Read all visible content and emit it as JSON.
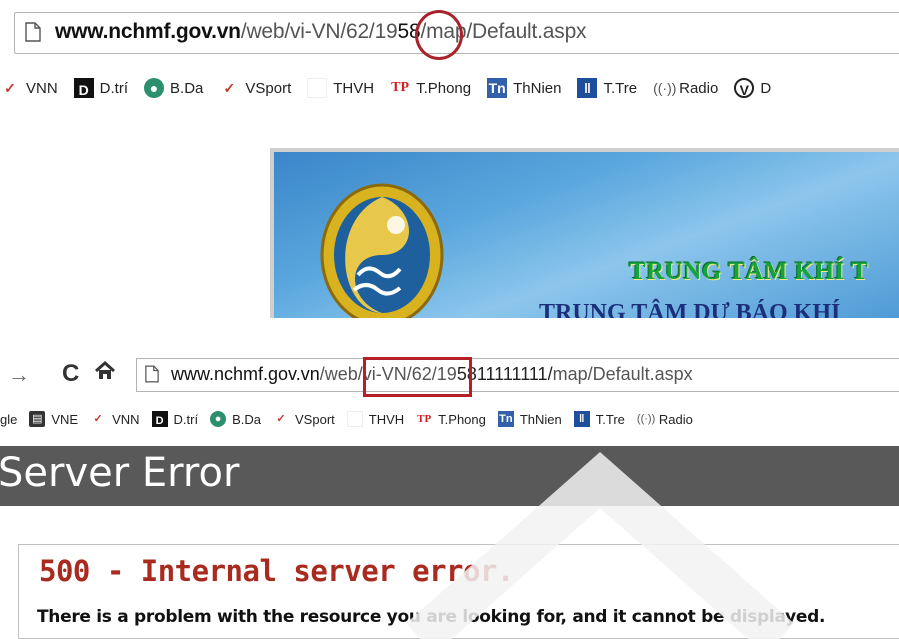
{
  "top": {
    "url": {
      "host": "www.nchmf.gov.vn",
      "path_before": "/web/vi-VN/62/19",
      "highlight": "58",
      "path_after": "/map/Default.aspx"
    },
    "bookmarks": [
      {
        "label": "VNN",
        "icon": "check-icon"
      },
      {
        "label": "D.trí",
        "icon": "d-icon",
        "glyph": "D"
      },
      {
        "label": "B.Da",
        "icon": "bda-icon"
      },
      {
        "label": "VSport",
        "icon": "check-icon"
      },
      {
        "label": "THVH",
        "icon": "blank-icon"
      },
      {
        "label": "T.Phong",
        "icon": "tp-icon",
        "glyph": "TP"
      },
      {
        "label": "ThNien",
        "icon": "tn-icon",
        "glyph": "Tn"
      },
      {
        "label": "T.Tre",
        "icon": "tt-icon"
      },
      {
        "label": "Radio",
        "icon": "radio-icon"
      },
      {
        "label": "D",
        "icon": "v-icon",
        "glyph": "V"
      }
    ],
    "banner": {
      "title": "TRUNG TÂM KHÍ T",
      "subtitle": "TRUNG TÂM DỰ BÁO KHÍ"
    }
  },
  "bottom": {
    "url": {
      "host": "www.nchmf.gov.vn",
      "path_before": "/web/vi-VN/62/19",
      "highlight": "5811111111/",
      "path_after": "map/Default.aspx"
    },
    "bookmarks": [
      {
        "label": "gle",
        "icon": "none"
      },
      {
        "label": "VNE",
        "icon": "vne-icon"
      },
      {
        "label": "VNN",
        "icon": "check-icon"
      },
      {
        "label": "D.trí",
        "icon": "d-icon",
        "glyph": "D"
      },
      {
        "label": "B.Da",
        "icon": "bda-icon"
      },
      {
        "label": "VSport",
        "icon": "check-icon"
      },
      {
        "label": "THVH",
        "icon": "blank-icon"
      },
      {
        "label": "T.Phong",
        "icon": "tp-icon",
        "glyph": "TP"
      },
      {
        "label": "ThNien",
        "icon": "tn-icon",
        "glyph": "Tn"
      },
      {
        "label": "T.Tre",
        "icon": "tt-icon"
      },
      {
        "label": "Radio",
        "icon": "radio-icon"
      }
    ],
    "error_header": "Server Error",
    "error_code": "500 - Internal server error.",
    "error_message": "There is a problem with the resource you are looking for, and it cannot be displayed."
  },
  "colors": {
    "annotation_red": "#b51f26",
    "error_header_bg": "#595959",
    "error_code": "#a92b1f",
    "banner_title": "#15a33c"
  }
}
